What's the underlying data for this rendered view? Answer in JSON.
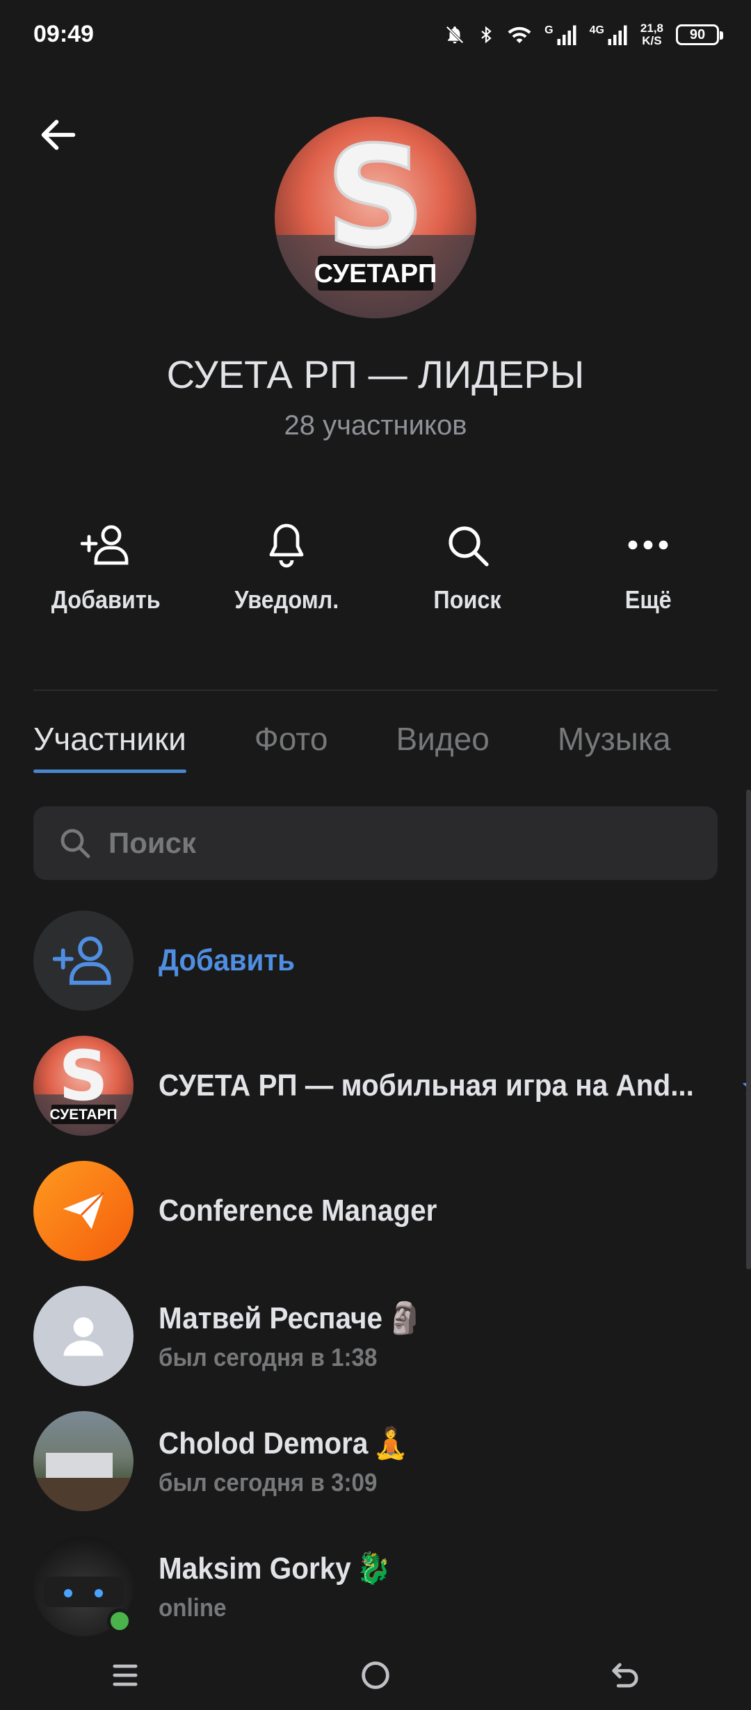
{
  "status_bar": {
    "time": "09:49",
    "net_g": "G",
    "net_4g": "4G",
    "speed_value": "21,8",
    "speed_unit": "K/S",
    "battery": "90"
  },
  "header": {
    "title": "СУЕТА РП — ЛИДЕРЫ",
    "subtitle": "28 участников",
    "avatar_text": "СУЕТАРП"
  },
  "actions": [
    {
      "label": "Добавить",
      "icon": "add-user-icon"
    },
    {
      "label": "Уведомл.",
      "icon": "bell-icon"
    },
    {
      "label": "Поиск",
      "icon": "search-icon"
    },
    {
      "label": "Ещё",
      "icon": "more-icon"
    }
  ],
  "tabs": [
    {
      "label": "Участники",
      "active": true
    },
    {
      "label": "Фото",
      "active": false
    },
    {
      "label": "Видео",
      "active": false
    },
    {
      "label": "Музыка",
      "active": false
    }
  ],
  "search": {
    "placeholder": "Поиск"
  },
  "add_member": {
    "label": "Добавить"
  },
  "members": [
    {
      "name": "СУЕТА РП — мобильная игра на And...",
      "status": "",
      "avatar_text": "СУЕТАРП",
      "verified": true
    },
    {
      "name": "Conference Manager",
      "status": ""
    },
    {
      "name": "Матвей Респаче",
      "emoji": "🗿",
      "status": "был сегодня в 1:38"
    },
    {
      "name": "Cholod Demora",
      "emoji": "🧘",
      "status": "был сегодня в 3:09"
    },
    {
      "name": "Maksim Gorky",
      "emoji": "🐉",
      "status": "online"
    }
  ],
  "colors": {
    "background": "#19191a",
    "accent": "#4986cc",
    "link": "#4f8ee0",
    "secondary_text": "#76787a"
  }
}
